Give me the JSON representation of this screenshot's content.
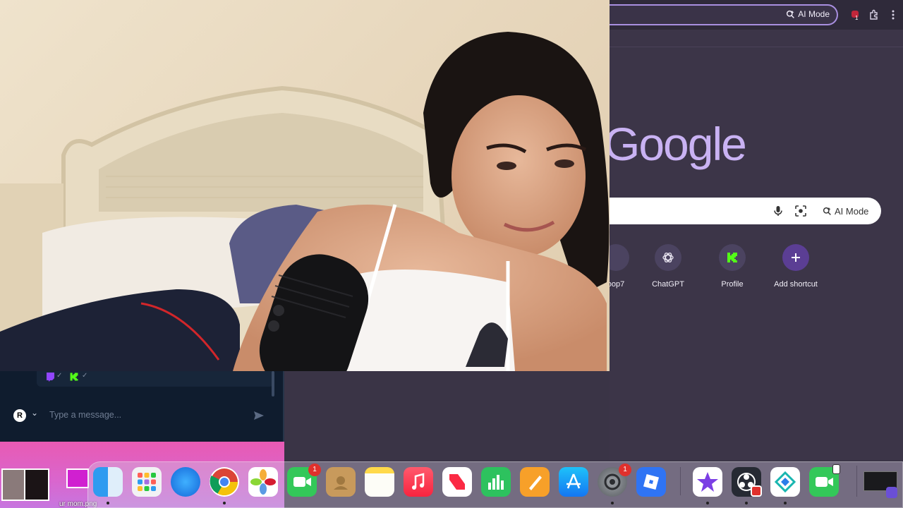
{
  "browser": {
    "toolbar": {
      "ai_mode_label": "AI Mode",
      "extension_badge": "1"
    },
    "logo_text": "Google",
    "search": {
      "ai_mode_label": "AI Mode"
    },
    "shortcuts": [
      {
        "label": "oop7",
        "icon": "partial-shortcut-icon"
      },
      {
        "label": "ChatGPT",
        "icon": "chatgpt-icon"
      },
      {
        "label": "Profile",
        "icon": "kick-icon"
      },
      {
        "label": "Add shortcut",
        "icon": "plus-icon"
      }
    ]
  },
  "chat": {
    "avatar_letter": "R",
    "placeholder": "Type a message..."
  },
  "desktop": {
    "file_label": "ur mom.png"
  },
  "dock": {
    "facetime_badge": "1",
    "settings_badge": "1",
    "apps": [
      "Finder",
      "Launchpad",
      "Safari",
      "Chrome",
      "Photos",
      "FaceTime",
      "Contacts",
      "Notes",
      "Music",
      "News",
      "Numbers",
      "Pages",
      "App Store",
      "System Settings",
      "Roblox",
      "iMovie",
      "OBS",
      "Pivot",
      "FaceTime"
    ]
  },
  "colors": {
    "browser_bg": "#3c3548",
    "accent": "#a98fe0",
    "chat_bg": "#0f1c2e",
    "pink_strip": "#e85ab3"
  }
}
